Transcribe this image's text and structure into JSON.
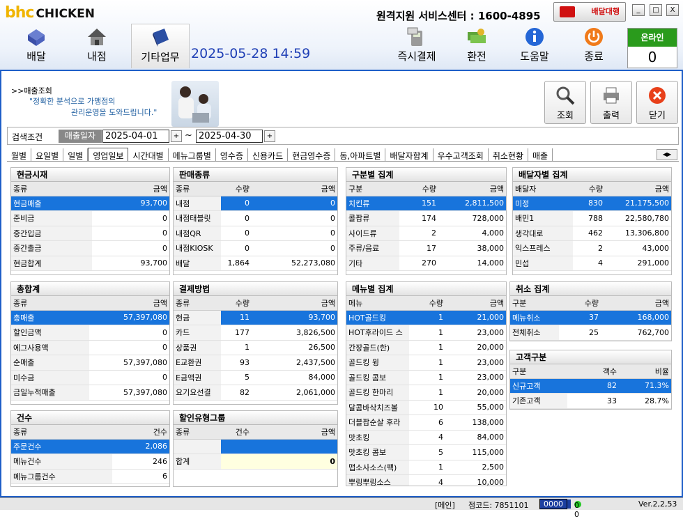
{
  "header": {
    "logo_a": "bhc",
    "logo_b": "CHICKEN",
    "datetime": "2025-05-28 14:59",
    "service_center": "원격지원 서비스센터 : 1600-4895",
    "delivery_agent": "배달대행",
    "online_label": "온라인",
    "online_count": "0",
    "nav": [
      {
        "label": "배달",
        "icon": "delivery-box-icon"
      },
      {
        "label": "내점",
        "icon": "house-icon"
      },
      {
        "label": "기타업무",
        "icon": "book-icon"
      }
    ],
    "tools": [
      {
        "label": "즉시결제",
        "icon": "card-terminal-icon"
      },
      {
        "label": "환전",
        "icon": "money-icon"
      },
      {
        "label": "도움말",
        "icon": "info-icon"
      },
      {
        "label": "종료",
        "icon": "power-icon"
      }
    ],
    "window": [
      "_",
      "□",
      "X"
    ]
  },
  "page": {
    "breadcrumb": ">>매출조회",
    "slogan1": "\"정확한 분석으로 가맹점의",
    "slogan2": "관리운영을 도와드립니다.\"",
    "actions": [
      {
        "label": "조회",
        "icon": "magnifier-icon"
      },
      {
        "label": "출력",
        "icon": "printer-icon"
      },
      {
        "label": "닫기",
        "icon": "close-icon"
      }
    ]
  },
  "search": {
    "label": "검색조건",
    "tag": "매출일자",
    "from": "2025-04-01",
    "to": "2025-04-30",
    "tilde": "~",
    "plus": "+"
  },
  "tabs": [
    "월별",
    "요일별",
    "일별",
    "영업일보",
    "시간대별",
    "메뉴그룹별",
    "영수증",
    "신용카드",
    "현금영수증",
    "동,아파트별",
    "배달자합계",
    "우수고객조회",
    "취소현황",
    "매출"
  ],
  "tab_scroll": [
    "◀",
    "▶"
  ],
  "panels": {
    "cash": {
      "title": "현금시재",
      "cols": [
        "종류",
        "금액"
      ],
      "rows": [
        [
          "현금매출",
          "93,700"
        ],
        [
          "준비금",
          "0"
        ],
        [
          "중간입금",
          "0"
        ],
        [
          "중간출금",
          "0"
        ],
        [
          "현금합계",
          "93,700"
        ]
      ]
    },
    "sales_type": {
      "title": "판매종류",
      "cols": [
        "종류",
        "수량",
        "금액"
      ],
      "rows": [
        [
          "내점",
          "0",
          "0"
        ],
        [
          "내점태블릿",
          "0",
          "0"
        ],
        [
          "내점QR",
          "0",
          "0"
        ],
        [
          "내점KIOSK",
          "0",
          "0"
        ],
        [
          "배달",
          "1,864",
          "52,273,080"
        ]
      ]
    },
    "category": {
      "title": "구분별 집계",
      "cols": [
        "구분",
        "수량",
        "금액"
      ],
      "rows": [
        [
          "치킨류",
          "151",
          "2,811,500"
        ],
        [
          "콜팝류",
          "174",
          "728,000"
        ],
        [
          "사이드류",
          "2",
          "4,000"
        ],
        [
          "주류/음료",
          "17",
          "38,000"
        ],
        [
          "기타",
          "270",
          "14,000"
        ]
      ]
    },
    "courier": {
      "title": "배달자별 집계",
      "cols": [
        "배달자",
        "수량",
        "금액"
      ],
      "rows": [
        [
          "미정",
          "830",
          "21,175,500"
        ],
        [
          "배민1",
          "788",
          "22,580,780"
        ],
        [
          "생각대로",
          "462",
          "13,306,800"
        ],
        [
          "익스프레스",
          "2",
          "43,000"
        ],
        [
          "민섭",
          "4",
          "291,000"
        ]
      ]
    },
    "total": {
      "title": "총합계",
      "cols": [
        "종류",
        "금액"
      ],
      "rows": [
        [
          "총매출",
          "57,397,080"
        ],
        [
          "할인금액",
          "0"
        ],
        [
          "에그사용액",
          "0"
        ],
        [
          "순매출",
          "57,397,080"
        ],
        [
          "미수금",
          "0"
        ],
        [
          "금일누적매출",
          "57,397,080"
        ]
      ]
    },
    "payment": {
      "title": "결제방법",
      "cols": [
        "종류",
        "수량",
        "금액"
      ],
      "rows": [
        [
          "현금",
          "11",
          "93,700"
        ],
        [
          "카드",
          "177",
          "3,826,500"
        ],
        [
          "상품권",
          "1",
          "26,500"
        ],
        [
          "E교환권",
          "93",
          "2,437,500"
        ],
        [
          "E금액권",
          "5",
          "84,000"
        ],
        [
          "요기요선결",
          "82",
          "2,061,000"
        ]
      ]
    },
    "menu": {
      "title": "메뉴별 집계",
      "cols": [
        "메뉴",
        "수량",
        "금액"
      ],
      "rows": [
        [
          "HOT골드킹",
          "1",
          "21,000"
        ],
        [
          "HOT후라이드 스",
          "1",
          "23,000"
        ],
        [
          "간장골드(한)",
          "1",
          "20,000"
        ],
        [
          "골드킹 윙",
          "1",
          "23,000"
        ],
        [
          "골드킹 콤보",
          "1",
          "23,000"
        ],
        [
          "골드킹 한마리",
          "1",
          "20,000"
        ],
        [
          "달콤바삭치즈볼",
          "10",
          "55,000"
        ],
        [
          "더블팝순살 후라",
          "6",
          "138,000"
        ],
        [
          "맛초킹",
          "4",
          "84,000"
        ],
        [
          "맛초킹 콤보",
          "5",
          "115,000"
        ],
        [
          "맵소사소스(팩)",
          "1",
          "2,500"
        ],
        [
          "뿌링뿌링소스",
          "4",
          "10,000"
        ]
      ]
    },
    "cancel": {
      "title": "취소 집계",
      "cols": [
        "구분",
        "수량",
        "금액"
      ],
      "rows": [
        [
          "메뉴취소",
          "37",
          "168,000"
        ],
        [
          "전체취소",
          "25",
          "762,700"
        ]
      ]
    },
    "customer": {
      "title": "고객구분",
      "cols": [
        "구분",
        "객수",
        "비율"
      ],
      "rows": [
        [
          "신규고객",
          "82",
          "71.3%"
        ],
        [
          "기존고객",
          "33",
          "28.7%"
        ]
      ]
    },
    "count": {
      "title": "건수",
      "cols": [
        "종류",
        "건수"
      ],
      "rows": [
        [
          "주문건수",
          "2,086"
        ],
        [
          "메뉴건수",
          "246"
        ],
        [
          "메뉴그룹건수",
          "6"
        ]
      ]
    },
    "discount": {
      "title": "할인유형그룹",
      "cols": [
        "종류",
        "건수",
        "금액"
      ],
      "rows": [
        [
          "",
          "",
          ""
        ]
      ],
      "sum_label": "합계",
      "sum_value": "0"
    }
  },
  "status": {
    "screen": "[메인]",
    "store": "점코드: 7851101",
    "code": "0000",
    "counts": "0 0",
    "version": "Ver.2,2,53"
  },
  "colors": {
    "accent": "#1874dc",
    "frame": "#1f5fc8",
    "online": "#2a9b1c",
    "alert": "#d01010"
  }
}
